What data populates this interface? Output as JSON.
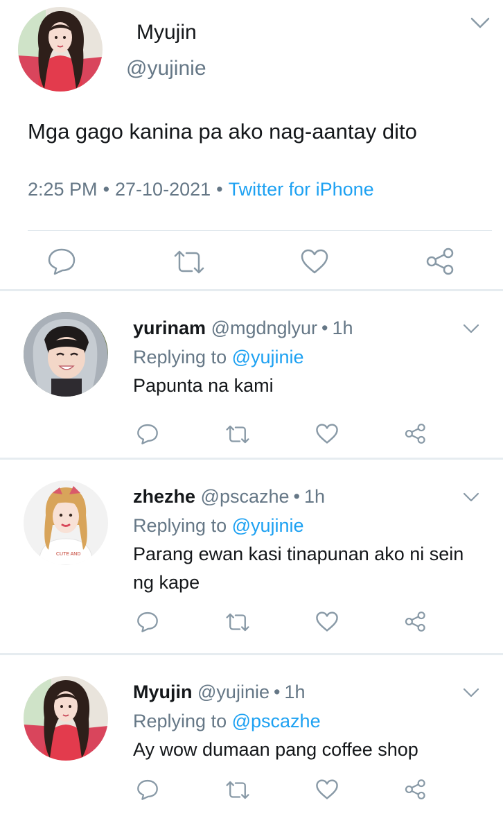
{
  "main_tweet": {
    "name": "Myujin",
    "handle": "@yujinie",
    "text": "Mga gago kanina pa ako nag-aantay dito",
    "time": "2:25 PM",
    "separator": "•",
    "date": "27-10-2021",
    "source": "Twitter for iPhone",
    "actions": [
      "reply-icon",
      "retweet-icon",
      "like-icon",
      "share-icon"
    ]
  },
  "replies": [
    {
      "name": "yurinam",
      "handle": "@mgdnglyur",
      "dot": "•",
      "time": "1h",
      "replying_prefix": "Replying to",
      "replying_to": "@yujinie",
      "text": "Papunta na kami"
    },
    {
      "name": "zhezhe",
      "handle": "@pscazhe",
      "dot": "•",
      "time": "1h",
      "replying_prefix": "Replying to",
      "replying_to": "@yujinie",
      "text": "Parang ewan kasi tinapunan ako ni sein ng kape",
      "shirt_text": "CUTE AND"
    },
    {
      "name": "Myujin",
      "handle": "@yujinie",
      "dot": "•",
      "time": "1h",
      "replying_prefix": "Replying to",
      "replying_to": "@pscazhe",
      "text": "Ay wow dumaan pang coffee shop"
    }
  ],
  "colors": {
    "text": "#14171a",
    "secondary": "#657786",
    "accent": "#1da1f2",
    "icon": "#8899a6",
    "divider": "#e6ecf0"
  }
}
